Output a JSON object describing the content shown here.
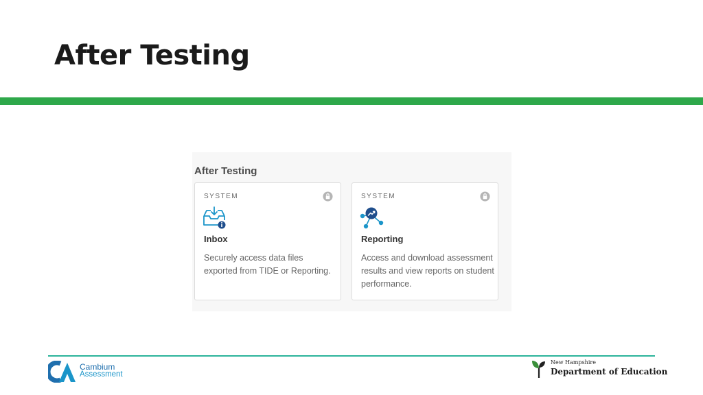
{
  "slide": {
    "title": "After Testing"
  },
  "panel": {
    "heading": "After Testing",
    "cards": [
      {
        "label": "SYSTEM",
        "title": "Inbox",
        "description": "Securely access data files exported from TIDE or Reporting.",
        "icon": "inbox-download-icon",
        "status_icon": "lock-icon"
      },
      {
        "label": "SYSTEM",
        "title": "Reporting",
        "description": "Access and download assessment results and view reports on student performance.",
        "icon": "reporting-network-icon",
        "status_icon": "lock-icon"
      }
    ]
  },
  "footer": {
    "left_logo": {
      "line1": "Cambium",
      "line2": "Assessment"
    },
    "right_logo": {
      "line1": "New Hampshire",
      "line2": "Department of Education"
    }
  },
  "colors": {
    "accent_green": "#2ea84a",
    "footer_line": "#2bb39a",
    "cambium_blue": "#1f6fae",
    "icon_blue": "#1b95c9"
  }
}
